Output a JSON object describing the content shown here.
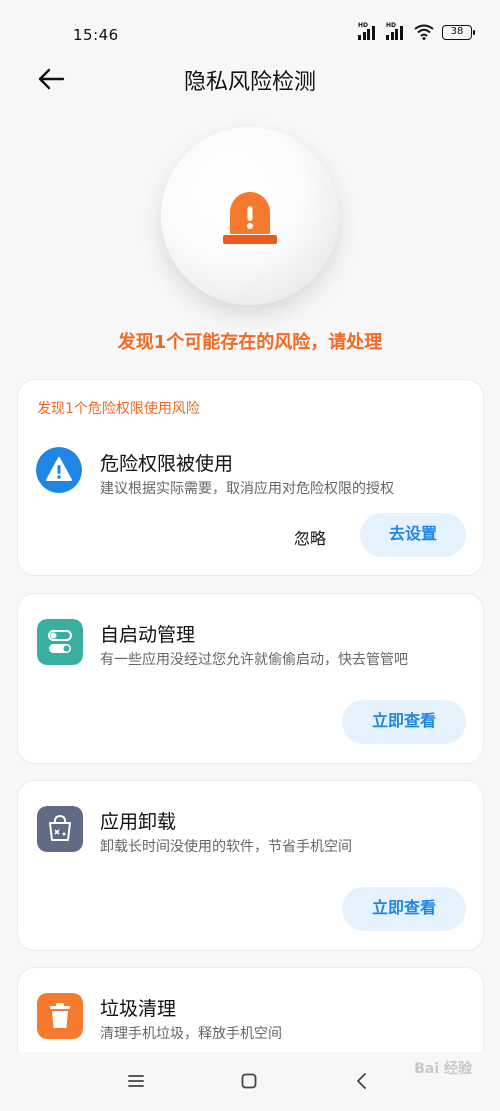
{
  "status_bar": {
    "time": "15:46",
    "hd1": "HD",
    "hd2": "HD",
    "battery": "38"
  },
  "header": {
    "title": "隐私风险检测"
  },
  "hero": {
    "message": "发现1个可能存在的风险，请处理"
  },
  "cards": [
    {
      "section_label": "发现1个危险权限使用风险",
      "title": "危险权限被使用",
      "desc": "建议根据实际需要，取消应用对危险权限的授权",
      "ignore_label": "忽略",
      "action_label": "去设置",
      "icon": "warning-icon",
      "icon_color": "#1f86e3"
    },
    {
      "title": "自启动管理",
      "desc": "有一些应用没经过您允许就偷偷启动，快去管管吧",
      "action_label": "立即查看",
      "icon": "toggle-switch-icon",
      "icon_color": "#3aaea0"
    },
    {
      "title": "应用卸载",
      "desc": "卸载长时间没使用的软件，节省手机空间",
      "action_label": "立即查看",
      "icon": "uninstall-bag-icon",
      "icon_color": "#5f6a84"
    },
    {
      "title": "垃圾清理",
      "desc": "清理手机垃圾，释放手机空间",
      "icon": "trash-icon",
      "icon_color": "#f57a2e"
    }
  ],
  "nav": {
    "menu": "menu-icon",
    "home": "home-icon",
    "back": "back-icon"
  },
  "watermark": "Bai 经验",
  "colors": {
    "accent_orange": "#f06a24",
    "accent_blue": "#1f86e3",
    "pill_bg": "#e5f2fd"
  }
}
